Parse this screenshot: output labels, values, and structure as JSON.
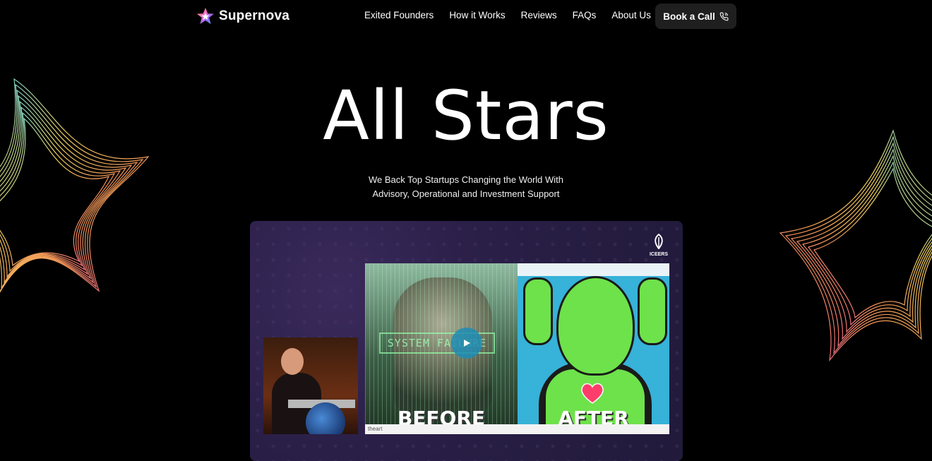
{
  "brand": {
    "name": "Supernova"
  },
  "nav": {
    "links": [
      "Exited Founders",
      "How it Works",
      "Reviews",
      "FAQs",
      "About Us"
    ],
    "cta_label": "Book a Call"
  },
  "hero": {
    "title": "All Stars",
    "subtitle_line1": "We Back Top Startups Changing the World With",
    "subtitle_line2": "Advisory, Operational and Investment Support"
  },
  "video": {
    "watermark": "ICEERS",
    "overlay_label": "SYSTEM FAILURE",
    "before_caption": "BEFORE",
    "after_caption": "AFTER",
    "footer_text": "theart"
  },
  "colors": {
    "background": "#000000",
    "cta_background": "#1f1f1f",
    "video_background": "#2a1f47"
  },
  "icons": [
    "star-logo-icon",
    "phone-icon",
    "play-icon",
    "iceers-leaf-icon"
  ]
}
